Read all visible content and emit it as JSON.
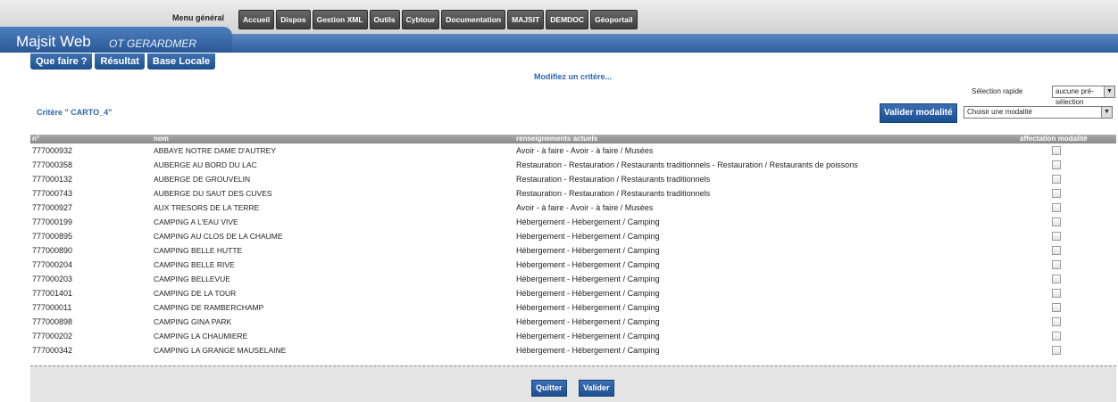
{
  "topbar": {
    "menu_label": "Menu général",
    "items": [
      "Accueil",
      "Dispos",
      "Gestion XML",
      "Outils",
      "Cybtour",
      "Documentation",
      "MAJSIT",
      "DEMDOC",
      "Géoportail"
    ]
  },
  "header": {
    "title": "Majsit Web",
    "subtitle": "OT GERARDMER"
  },
  "subtabs": [
    "Que faire ?",
    "Résultat",
    "Base Locale"
  ],
  "main": {
    "prompt": "Modifiez un critère...",
    "quick_select_label": "Sélection rapide",
    "quick_select_value": "aucune pré-sélection",
    "criterion": "Critère \" CARTO_4\"",
    "validate_mod_label": "Valider modalité",
    "mod_select_value": "Choisir une modalité"
  },
  "table": {
    "headers": [
      "n°",
      "nom",
      "renseignements actuels",
      "affectation modalité"
    ],
    "rows": [
      {
        "num": "777000932",
        "nom": "ABBAYE NOTRE DAME D'AUTREY",
        "rens": "Avoir - à faire - Avoir - à faire / Musées"
      },
      {
        "num": "777000358",
        "nom": "AUBERGE AU BORD DU LAC",
        "rens": "Restauration - Restauration / Restaurants traditionnels - Restauration / Restaurants de poissons"
      },
      {
        "num": "777000132",
        "nom": "AUBERGE DE GROUVELIN",
        "rens": "Restauration - Restauration / Restaurants traditionnels"
      },
      {
        "num": "777000743",
        "nom": "AUBERGE DU SAUT DES CUVES",
        "rens": "Restauration - Restauration / Restaurants traditionnels"
      },
      {
        "num": "777000927",
        "nom": "AUX TRESORS DE LA TERRE",
        "rens": "Avoir - à faire - Avoir - à faire / Musées"
      },
      {
        "num": "777000199",
        "nom": "CAMPING A L'EAU VIVE",
        "rens": "Hébergement - Hébergement / Camping"
      },
      {
        "num": "777000895",
        "nom": "CAMPING AU CLOS DE LA CHAUME",
        "rens": "Hébergement - Hébergement / Camping"
      },
      {
        "num": "777000890",
        "nom": "CAMPING BELLE HUTTE",
        "rens": "Hébergement - Hébergement / Camping"
      },
      {
        "num": "777000204",
        "nom": "CAMPING BELLE RIVE",
        "rens": "Hébergement - Hébergement / Camping"
      },
      {
        "num": "777000203",
        "nom": "CAMPING BELLEVUE",
        "rens": "Hébergement - Hébergement / Camping"
      },
      {
        "num": "777001401",
        "nom": "CAMPING DE LA TOUR",
        "rens": "Hébergement - Hébergement / Camping"
      },
      {
        "num": "777000011",
        "nom": "CAMPING DE RAMBERCHAMP",
        "rens": "Hébergement - Hébergement / Camping"
      },
      {
        "num": "777000898",
        "nom": "CAMPING GINA PARK",
        "rens": "Hébergement - Hébergement / Camping"
      },
      {
        "num": "777000202",
        "nom": "CAMPING LA CHAUMIERE",
        "rens": "Hébergement - Hébergement / Camping"
      },
      {
        "num": "777000342",
        "nom": "CAMPING LA GRANGE MAUSELAINE",
        "rens": "Hébergement - Hébergement / Camping"
      }
    ]
  },
  "footer": {
    "quit_label": "Quitter",
    "validate_label": "Valider"
  }
}
